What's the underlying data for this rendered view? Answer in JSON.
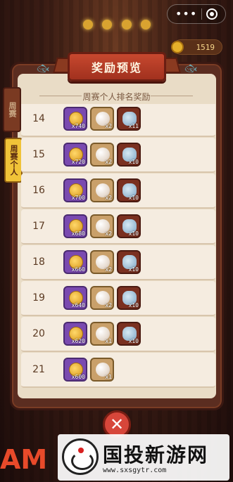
{
  "header": {
    "title": "奖励预览",
    "subtitle": "周赛个人排名奖励",
    "coins": "1519"
  },
  "tabs": [
    {
      "label": "周赛"
    },
    {
      "label": "周赛个人"
    }
  ],
  "rows": [
    {
      "rank": "14",
      "rewards": [
        {
          "type": "purple",
          "qty": "x740"
        },
        {
          "type": "tan",
          "qty": "x2"
        },
        {
          "type": "red",
          "qty": "x11"
        }
      ]
    },
    {
      "rank": "15",
      "rewards": [
        {
          "type": "purple",
          "qty": "x720"
        },
        {
          "type": "tan",
          "qty": "x2"
        },
        {
          "type": "red",
          "qty": "x10"
        }
      ]
    },
    {
      "rank": "16",
      "rewards": [
        {
          "type": "purple",
          "qty": "x700"
        },
        {
          "type": "tan",
          "qty": "x2"
        },
        {
          "type": "red",
          "qty": "x10"
        }
      ]
    },
    {
      "rank": "17",
      "rewards": [
        {
          "type": "purple",
          "qty": "x680"
        },
        {
          "type": "tan",
          "qty": "x2"
        },
        {
          "type": "red",
          "qty": "x10"
        }
      ]
    },
    {
      "rank": "18",
      "rewards": [
        {
          "type": "purple",
          "qty": "x660"
        },
        {
          "type": "tan",
          "qty": "x2"
        },
        {
          "type": "red",
          "qty": "x10"
        }
      ]
    },
    {
      "rank": "19",
      "rewards": [
        {
          "type": "purple",
          "qty": "x640"
        },
        {
          "type": "tan",
          "qty": "x2"
        },
        {
          "type": "red",
          "qty": "x10"
        }
      ]
    },
    {
      "rank": "20",
      "rewards": [
        {
          "type": "purple",
          "qty": "x620"
        },
        {
          "type": "tan",
          "qty": "x1"
        },
        {
          "type": "red",
          "qty": "x10"
        }
      ]
    },
    {
      "rank": "21",
      "rewards": [
        {
          "type": "purple",
          "qty": "x600"
        },
        {
          "type": "tan",
          "qty": "x1"
        }
      ]
    }
  ],
  "close": {
    "label": "✕"
  },
  "branding": {
    "game_letters": "AM"
  },
  "watermark": {
    "title": "国投新游网",
    "url": "www.sxsgytr.com"
  }
}
